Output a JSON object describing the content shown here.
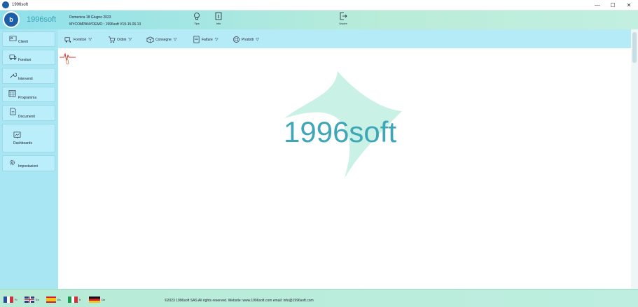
{
  "window": {
    "title": "1996soft",
    "minimize": "—",
    "maximize": "☐",
    "close": "✕"
  },
  "header": {
    "brand": "1996soft",
    "logo_text": "b",
    "date": "Domenica 18 Giugno 2023",
    "company": "MYCOMPANYDEMO : 1996soft V19-15.06.13",
    "tips_label": "Tips",
    "info_label": "Info",
    "exit_label": "Uscire"
  },
  "sidebar": {
    "items": [
      {
        "label": "Clienti",
        "icon": "clients-icon"
      },
      {
        "label": "Fornitori",
        "icon": "suppliers-icon"
      },
      {
        "label": "Interventi",
        "icon": "wrench-icon"
      },
      {
        "label": "Programma",
        "icon": "calendar-icon"
      },
      {
        "label": "Documenti",
        "icon": "document-icon"
      },
      {
        "label": "Dashboards",
        "icon": "chart-icon"
      },
      {
        "label": "Impostazioni",
        "icon": "gear-icon"
      }
    ]
  },
  "toolbar": {
    "items": [
      {
        "label": "Fornitori",
        "icon": "truck-icon"
      },
      {
        "label": "Ordini",
        "icon": "cart-icon"
      },
      {
        "label": "Consegne",
        "icon": "box-icon"
      },
      {
        "label": "Fatture",
        "icon": "invoice-icon"
      },
      {
        "label": "Prodotti",
        "icon": "product-icon"
      }
    ]
  },
  "main": {
    "watermark": "1996soft"
  },
  "footer": {
    "languages": [
      {
        "code": "Fr",
        "colors": [
          "#2a4fa0",
          "#ffffff",
          "#d4303a"
        ]
      },
      {
        "code": "En",
        "colors": [
          "#2a3f86",
          "#ffffff",
          "#c8202e"
        ]
      },
      {
        "code": "Es",
        "colors": [
          "#c8202e",
          "#f4c21b",
          "#c8202e"
        ]
      },
      {
        "code": "It",
        "colors": [
          "#1a9a4a",
          "#ffffff",
          "#d4303a"
        ]
      },
      {
        "code": "De",
        "colors": [
          "#111111",
          "#d4202a",
          "#f6c51a"
        ]
      }
    ],
    "copyright": "©2023 1996soft SAS All rights reserved. Website: www.1996soft.com email: info@1996soft.com"
  },
  "colors": {
    "accent": "#3fa6b8",
    "sidebar": "#a9e6f4",
    "logo": "#1d5ea8"
  }
}
